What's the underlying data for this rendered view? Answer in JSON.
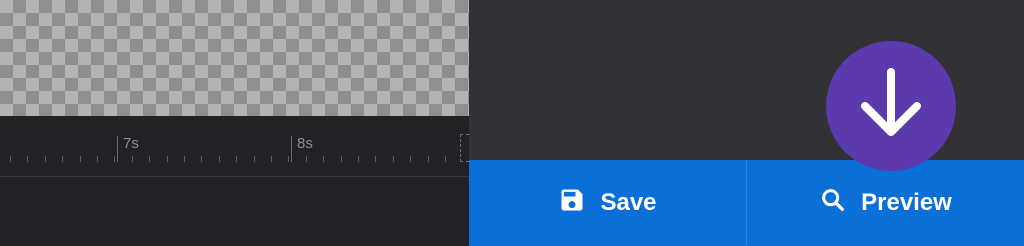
{
  "timeline": {
    "labels": [
      "7s",
      "8s"
    ]
  },
  "actions": {
    "save_label": "Save",
    "preview_label": "Preview"
  },
  "icons": {
    "save": "save-icon",
    "preview": "search-icon",
    "download": "arrow-down-icon"
  },
  "colors": {
    "action_bar": "#0a6fd6",
    "fab": "#5c3aad",
    "panel": "#313136",
    "timeline": "#222226"
  }
}
